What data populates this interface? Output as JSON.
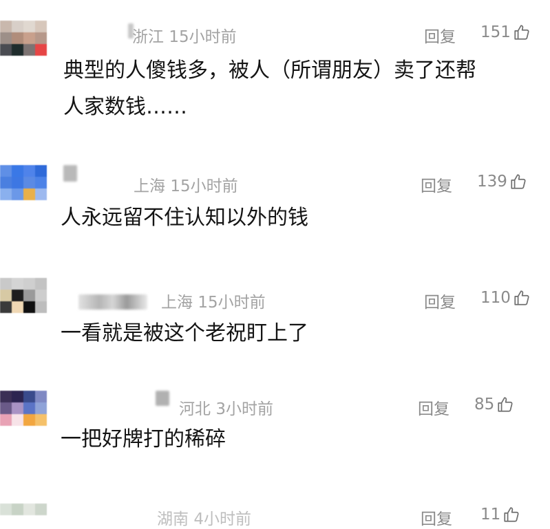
{
  "comments": [
    {
      "location": "浙江",
      "time": "15小时前",
      "reply": "回复",
      "likes": "151",
      "text_line1": "典型的人傻钱多，被人（所谓朋友）卖了还帮",
      "text_line2": "人家数钱……"
    },
    {
      "location": "上海",
      "time": "15小时前",
      "reply": "回复",
      "likes": "139",
      "text_line1": "人永远留不住认知以外的钱"
    },
    {
      "location": "上海",
      "time": "15小时前",
      "reply": "回复",
      "likes": "110",
      "text_line1": "一看就是被这个老祝盯上了"
    },
    {
      "location": "河北",
      "time": "3小时前",
      "reply": "回复",
      "likes": "85",
      "text_line1": "一把好牌打的稀碎"
    },
    {
      "location": "湖南",
      "time": "4小时前",
      "reply": "回复",
      "likes": "11"
    }
  ],
  "colors": {
    "meta_text": "#a3a3a3",
    "action_text": "#8a8a8a",
    "content_text": "#141414"
  }
}
